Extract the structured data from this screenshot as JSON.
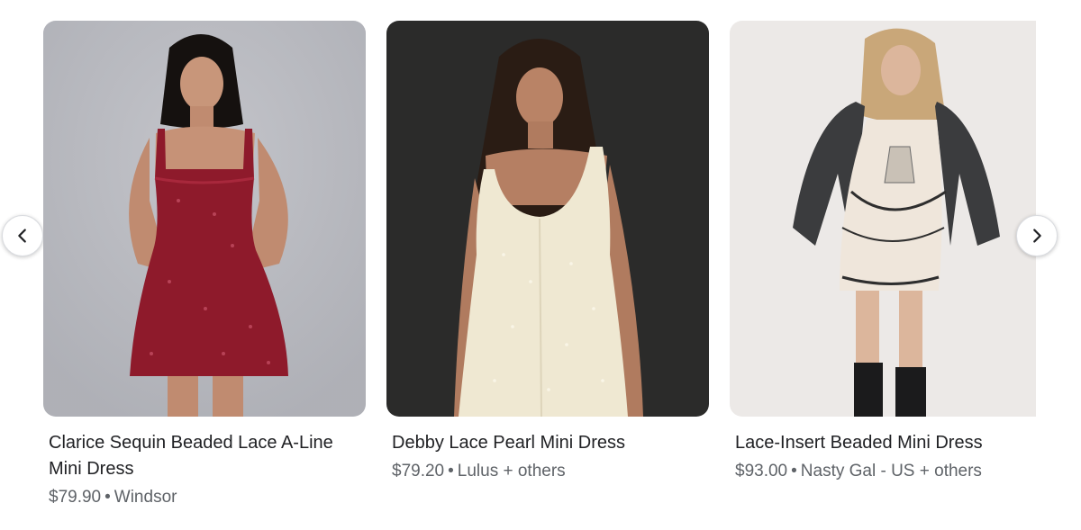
{
  "carousel": {
    "prev_icon": "chevron-left-icon",
    "next_icon": "chevron-right-icon",
    "items": [
      {
        "title": "Clarice Sequin Beaded Lace A-Line Mini Dress",
        "price": "$79.90",
        "seller": "Windsor",
        "image": "model-in-red-sequin-mini-dress",
        "colors": {
          "background": "#b9bac0",
          "dress": "#8e1a2b"
        }
      },
      {
        "title": "Debby Lace Pearl Mini Dress",
        "price": "$79.20",
        "seller": "Lulus + others",
        "image": "model-in-cream-lace-mini-dress",
        "colors": {
          "background": "#2b2b2a",
          "dress": "#efe8d2"
        }
      },
      {
        "title": "Lace-Insert Beaded Mini Dress",
        "price": "$93.00",
        "seller": "Nasty Gal - US + others",
        "image": "model-in-beaded-slip-dress-with-leather-jacket",
        "colors": {
          "background": "#ece9e7",
          "dress": "#efe6db"
        }
      }
    ]
  }
}
